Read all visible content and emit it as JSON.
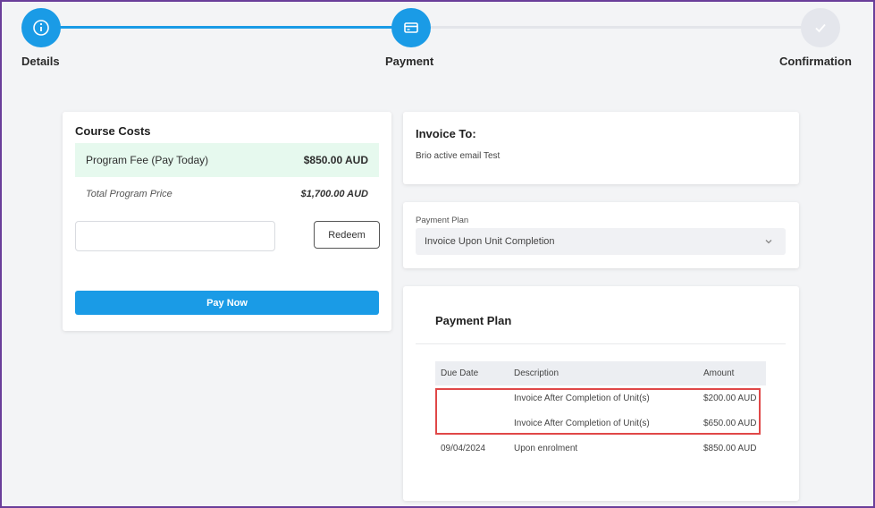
{
  "stepper": {
    "steps": [
      {
        "label": "Details",
        "icon": "info-icon",
        "state": "completed"
      },
      {
        "label": "Payment",
        "icon": "credit-card-icon",
        "state": "active"
      },
      {
        "label": "Confirmation",
        "icon": "check-icon",
        "state": "pending"
      }
    ]
  },
  "course_costs": {
    "title": "Course Costs",
    "fee_label": "Program Fee (Pay Today)",
    "fee_amount": "$850.00 AUD",
    "total_label": "Total Program Price",
    "total_amount": "$1,700.00 AUD",
    "promo_value": "",
    "redeem_label": "Redeem",
    "pay_label": "Pay Now"
  },
  "invoice": {
    "title": "Invoice To:",
    "recipient": "Brio active email Test"
  },
  "payment_plan_select": {
    "label": "Payment Plan",
    "selected": "Invoice Upon Unit Completion"
  },
  "plan_table": {
    "title": "Payment Plan",
    "headers": [
      "Due Date",
      "Description",
      "Amount"
    ],
    "rows": [
      {
        "due": "",
        "description": "Invoice After Completion of Unit(s)",
        "amount": "$200.00 AUD"
      },
      {
        "due": "",
        "description": "Invoice After Completion of Unit(s)",
        "amount": "$650.00 AUD"
      },
      {
        "due": "09/04/2024",
        "description": "Upon enrolment",
        "amount": "$850.00 AUD"
      }
    ]
  },
  "colors": {
    "accent": "#1a9be6",
    "fee_highlight": "#e6f9ee",
    "annotation_red": "#e04848",
    "frame": "#6a3e9a"
  }
}
